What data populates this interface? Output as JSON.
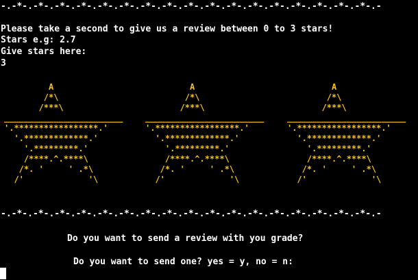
{
  "terminal": {
    "divider_top": "-.-*-.-*-.-*-.-*-.-*-.-*-.-*-.-*-.-*-.-*-.-*-.-*-.-*-.-*-.-*-.-*-.-*-.-",
    "divider_bottom": "-.-*-.-*-.-*-.-*-.-*-.-*-.-*-.-*-.-*-.-*-.-*-.-*-.-*-.-*-.-*-.-*-.-*-.-",
    "prompt_review": "Please take a second to give us a review between 0 to 3 stars!",
    "stars_example": "Stars e.g: 2.7",
    "give_stars_prompt": "Give stars here:",
    "stars_input_value": "3",
    "question_send_review": "Do you want to send a review with you grade?",
    "question_send_one": "Do you want to send one? yes = y, no = n:",
    "star_color": "#f2c21b",
    "stars": [
      "         A\n        /*\\\n       /***\\\n________________________\n'.*****************.'\n  '.*************.'\n    '.*********.'\n    /****.^.****\\\n   /*. '     ' .*\\\n  /'             '\\",
      "         A\n        /*\\\n       /***\\\n________________________\n'.*****************.'\n  '.*************.'\n    '.*********.'\n    /****.^.****\\\n   /*. '     ' .*\\\n  /'             '\\",
      "         A\n        /*\\\n       /***\\\n________________________\n'.*****************.'\n  '.*************.'\n    '.*********.'\n    /****.^.****\\\n   /*. '     ' .*\\\n  /'             '\\"
    ]
  }
}
